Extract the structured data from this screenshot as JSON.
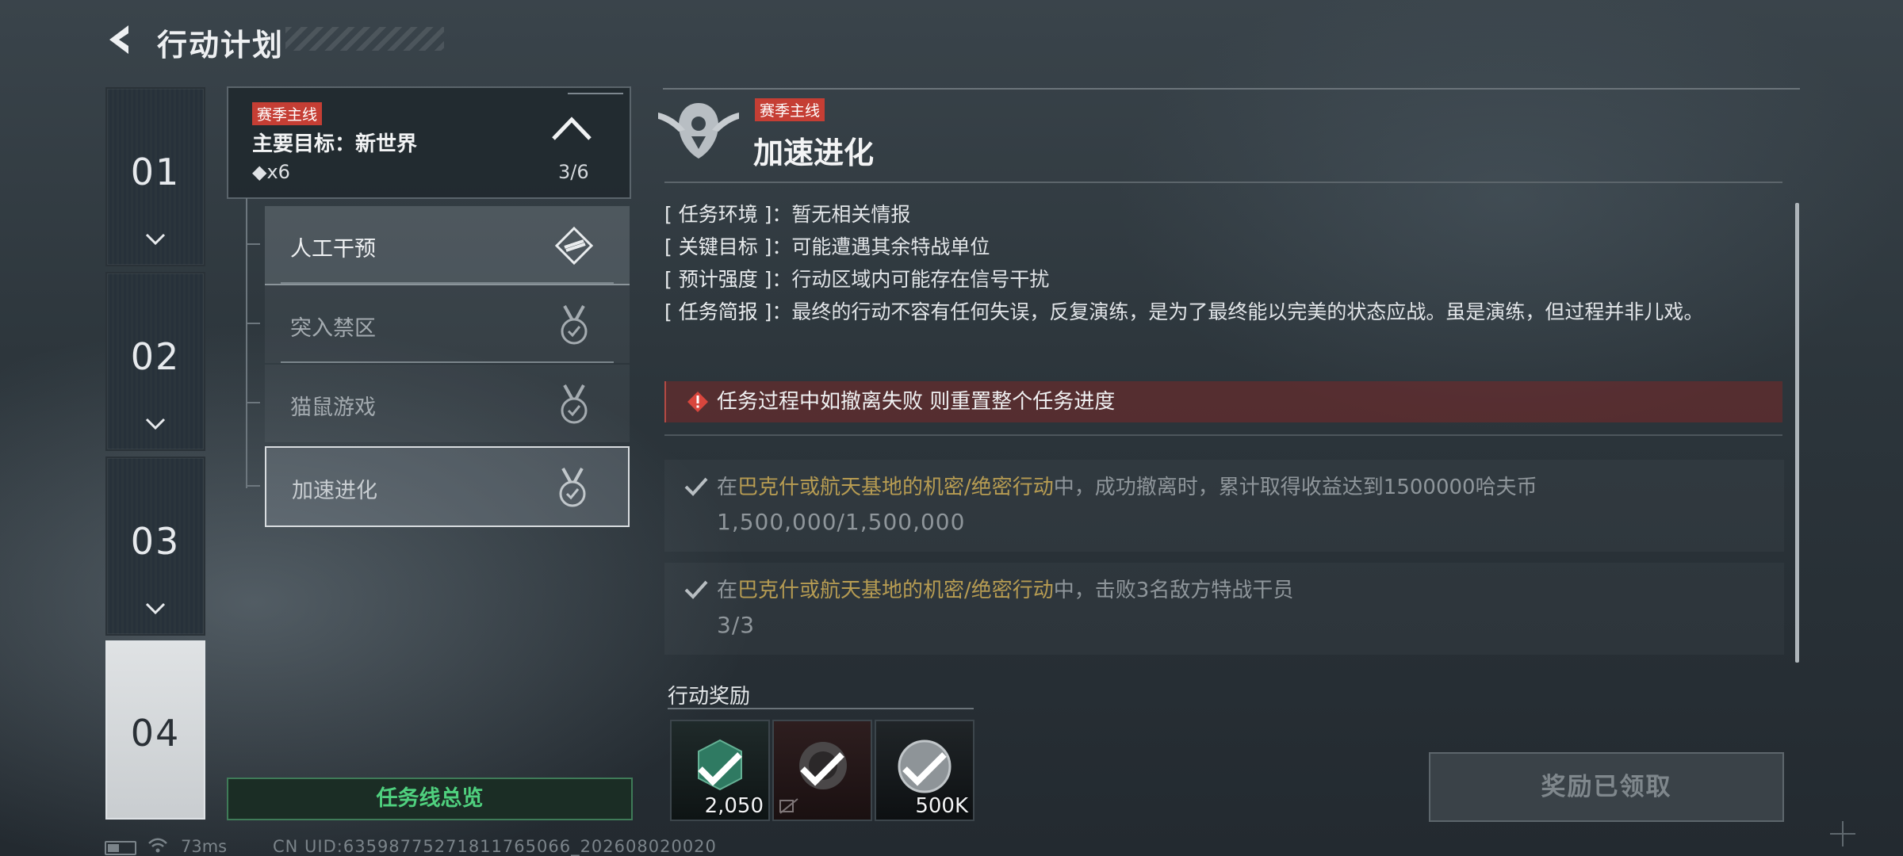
{
  "header": {
    "title": "行动计划",
    "back_icon": "arrow-left-icon"
  },
  "chapters": [
    {
      "num": "01",
      "active": false
    },
    {
      "num": "02",
      "active": false
    },
    {
      "num": "03",
      "active": false
    },
    {
      "num": "04",
      "active": true
    }
  ],
  "main_quest": {
    "tag": "赛季主线",
    "goal": "主要目标：新世界",
    "diamond_count": "◆x6",
    "progress": "3/6"
  },
  "sub_missions": [
    {
      "label": "人工干预",
      "status": "current"
    },
    {
      "label": "突入禁区",
      "status": "completed"
    },
    {
      "label": "猫鼠游戏",
      "status": "completed"
    },
    {
      "label": "加速进化",
      "status": "completed-selected"
    }
  ],
  "overview_button": "任务线总览",
  "detail": {
    "tag": "赛季主线",
    "title": "加速进化",
    "info": [
      {
        "key": "[ 任务环境 ]",
        "value": "：暂无相关情报"
      },
      {
        "key": "[ 关键目标 ]",
        "value": "：可能遭遇其余特战单位"
      },
      {
        "key": "[ 预计强度 ]",
        "value": "：行动区域内可能存在信号干扰"
      },
      {
        "key": "[ 任务简报 ]",
        "value": "：最终的行动不容有任何失误，反复演练，是为了最终能以完美的状态应战。虽是演练，但过程并非儿戏。"
      }
    ],
    "warning": "任务过程中如撤离失败 则重置整个任务进度",
    "objectives": [
      {
        "prefix": "在",
        "highlight": "巴克什或航天基地的机密/绝密行动",
        "suffix": "中，成功撤离时，累计取得收益达到1500000哈夫币",
        "progress": "1,500,000/1,500,000"
      },
      {
        "prefix": "在",
        "highlight": "巴克什或航天基地的机密/绝密行动",
        "suffix": "中，击败3名敌方特战干员",
        "progress": "3/3"
      }
    ],
    "rewards_label": "行动奖励",
    "rewards": [
      {
        "amount": "2,050",
        "icon": "badge-icon",
        "claimed": true
      },
      {
        "amount": "",
        "icon": "equipment-icon",
        "claimed": true
      },
      {
        "amount": "500K",
        "icon": "coin-icon",
        "claimed": true
      }
    ],
    "claim_button": "奖励已领取"
  },
  "status_bar": {
    "ping": "73ms",
    "uid": "CN UID:6359877527181176​5066_202608020020"
  },
  "colors": {
    "tag_red": "#c53e34",
    "highlight_gold": "#b79c52",
    "overview_green": "#4fd07e"
  }
}
